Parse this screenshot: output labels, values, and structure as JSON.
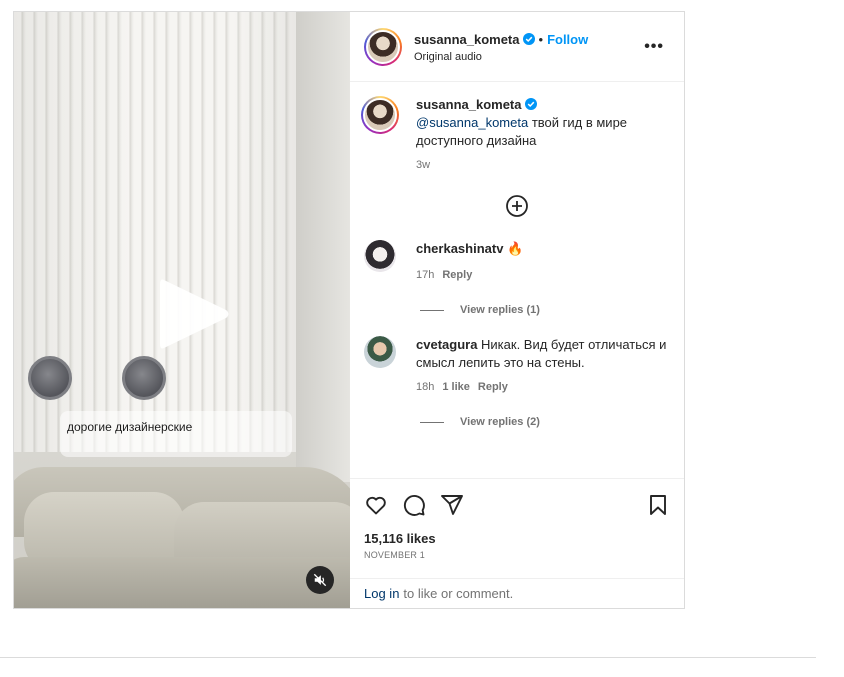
{
  "post": {
    "username": "susanna_kometa",
    "follow_label": "Follow",
    "separator": "•",
    "audio_label": "Original audio",
    "more_label": "•••",
    "video_caption": "дорогие дизайнерские",
    "caption": {
      "username": "susanna_kometa",
      "mention": "@susanna_kometa",
      "text": " твой гид в мире доступного дизайна",
      "time": "3w"
    },
    "comments": [
      {
        "username": "cherkashinatv",
        "text": " 🔥",
        "time": "17h",
        "likes": "",
        "reply_label": "Reply",
        "view_replies": "View replies (1)"
      },
      {
        "username": "cvetagura",
        "text": " Никак. Вид будет отличаться и смысл лепить это на стены.",
        "time": "18h",
        "likes": "1 like",
        "reply_label": "Reply",
        "view_replies": "View replies (2)"
      }
    ],
    "likes_count": "15,116 likes",
    "date": "NOVEMBER 1",
    "login_link": "Log in",
    "login_text": "to like or comment."
  },
  "icons": {
    "verified": "verified-badge-icon",
    "add_comment": "plus-circle-icon",
    "like": "heart-icon",
    "comment": "comment-icon",
    "share": "send-icon",
    "save": "bookmark-icon",
    "play": "play-icon",
    "mute": "muted-speaker-icon"
  },
  "colors": {
    "link": "#0095f6",
    "mention": "#00376b",
    "verified": "#0095f6"
  }
}
